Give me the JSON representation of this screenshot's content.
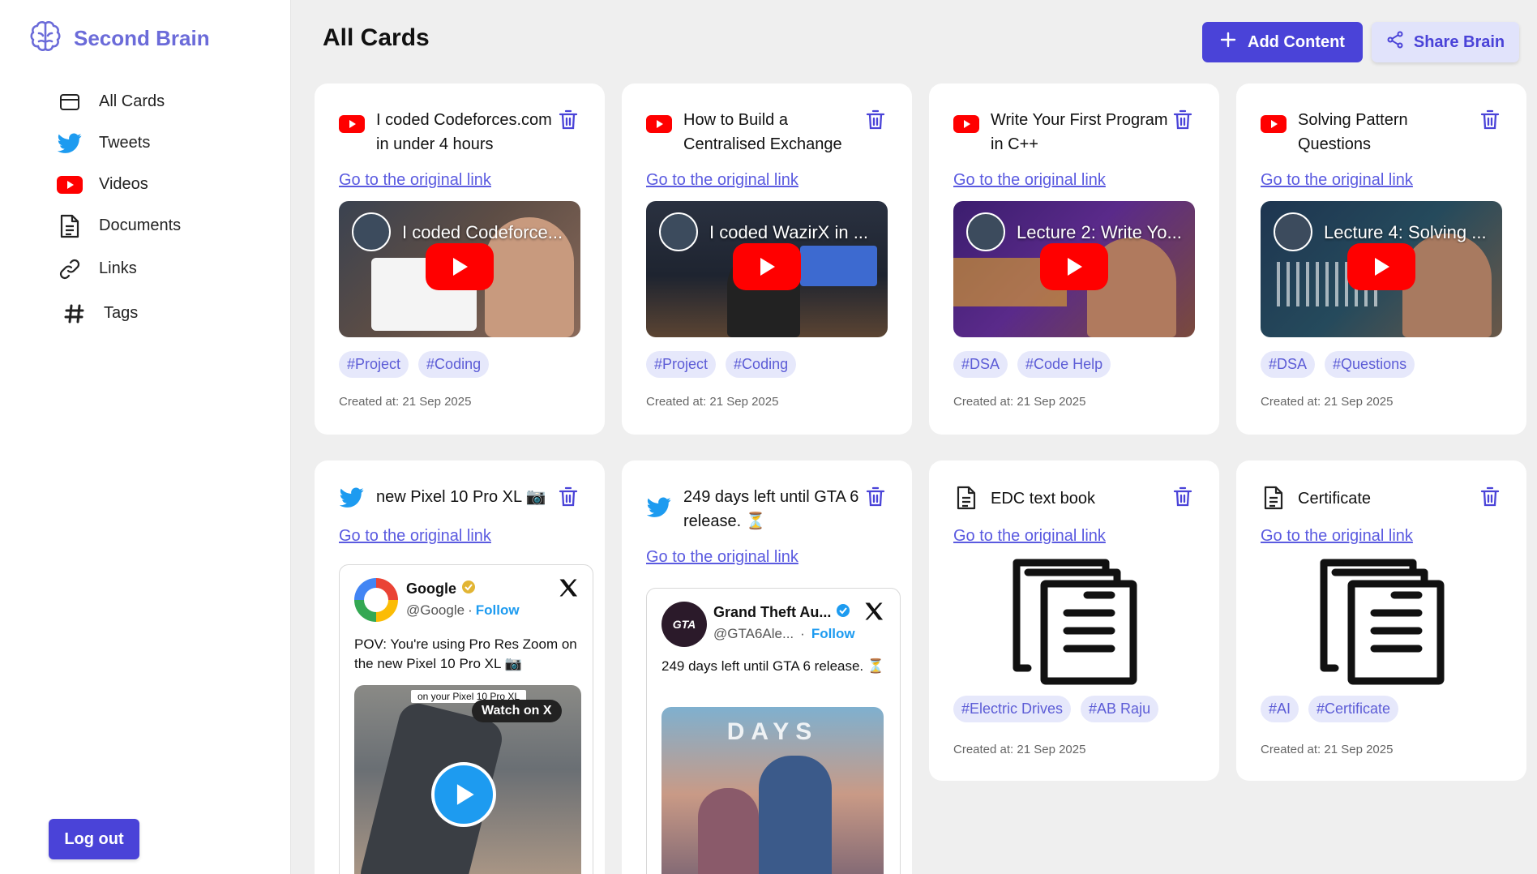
{
  "brand": {
    "name": "Second Brain"
  },
  "sidebar": {
    "items": [
      {
        "label": "All Cards",
        "icon": "card-icon"
      },
      {
        "label": "Tweets",
        "icon": "twitter-icon"
      },
      {
        "label": "Videos",
        "icon": "youtube-icon"
      },
      {
        "label": "Documents",
        "icon": "document-icon"
      },
      {
        "label": "Links",
        "icon": "link-icon"
      },
      {
        "label": "Tags",
        "icon": "hash-icon"
      }
    ],
    "logout_label": "Log out"
  },
  "header": {
    "title": "All Cards",
    "add_label": "Add Content",
    "share_label": "Share Brain"
  },
  "colors": {
    "accent": "#4a43d8",
    "tag_bg": "#e6e8fb",
    "tag_text": "#5c5cd6",
    "youtube": "#ff0000",
    "twitter": "#1d9bf0"
  },
  "link_label": "Go to the original link",
  "cards": [
    {
      "type": "video",
      "title": "I coded Codeforces.com in under 4 hours",
      "thumb_title": "I coded Codeforce...",
      "tags": [
        "#Project",
        "#Coding"
      ],
      "created": "Created at: 21 Sep 2025"
    },
    {
      "type": "video",
      "title": "How to Build a Centralised Exchange",
      "thumb_title": "I coded WazirX in ...",
      "tags": [
        "#Project",
        "#Coding"
      ],
      "created": "Created at: 21 Sep 2025"
    },
    {
      "type": "video",
      "title": "Write Your First Program in C++",
      "thumb_title": "Lecture 2: Write Yo...",
      "tags": [
        "#DSA",
        "#Code Help"
      ],
      "created": "Created at: 21 Sep 2025"
    },
    {
      "type": "video",
      "title": "Solving Pattern Questions",
      "thumb_title": "Lecture 4: Solving ...",
      "tags": [
        "#DSA",
        "#Questions"
      ],
      "created": "Created at: 21 Sep 2025"
    },
    {
      "type": "tweet",
      "title": "new Pixel 10 Pro XL 📷",
      "embed": {
        "name": "Google",
        "handle": "@Google",
        "follow": "Follow",
        "text": "POV: You're using Pro Res Zoom on the new Pixel 10 Pro XL 📷",
        "media_caption": "on your Pixel 10 Pro XL",
        "watch": "Watch on X"
      }
    },
    {
      "type": "tweet",
      "title": "249 days left until GTA 6 release. ⏳",
      "embed": {
        "name": "Grand Theft Au...",
        "handle": "@GTA6Ale...",
        "follow": "Follow",
        "text": "249 days left until GTA 6 release. ⏳",
        "media_caption": "DAYS"
      }
    },
    {
      "type": "document",
      "title": "EDC text book",
      "tags": [
        "#Electric Drives",
        "#AB Raju"
      ],
      "created": "Created at: 21 Sep 2025"
    },
    {
      "type": "document",
      "title": "Certificate",
      "tags": [
        "#AI",
        "#Certificate"
      ],
      "created": "Created at: 21 Sep 2025"
    }
  ]
}
